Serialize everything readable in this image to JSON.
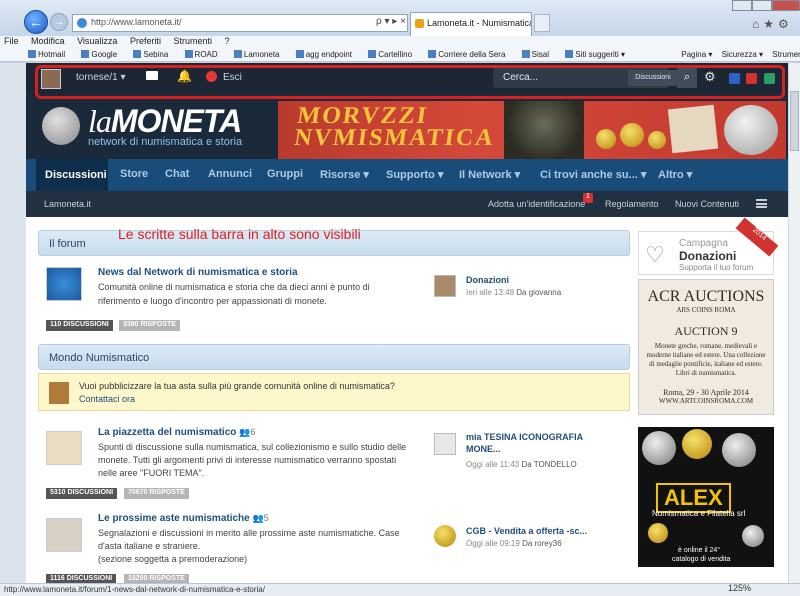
{
  "browser": {
    "url": "http://www.lamoneta.it/",
    "tab_title": "Lamoneta.it - Numismatica...",
    "url_tools": "ρ ▾ ▸ ×",
    "menu": [
      "File",
      "Modifica",
      "Visualizza",
      "Preferiti",
      "Strumenti",
      "?"
    ],
    "favorites": [
      "Hotmail",
      "Google",
      "Sebina",
      "ROAD",
      "Lamoneta",
      "agg endpoint",
      "Cartellino",
      "Corriere della Sera",
      "Sisal",
      "Siti suggeriti ▾"
    ],
    "fav_right": [
      "Pagina ▾",
      "Sicurezza ▾",
      "Strumenti ▾"
    ],
    "status_url": "http://www.lamoneta.it/forum/1-news-dal-network-di-numismatica-e-storia/",
    "zoom": "125%"
  },
  "topbar": {
    "username": "tornese/1 ▾",
    "logout": "Esci",
    "search_placeholder": "Cerca...",
    "search_scope": "Discussioni"
  },
  "site": {
    "logo_la": "la",
    "logo_main": "MONETA",
    "tagline": "network di numismatica e storia",
    "banner_line1": "MORVZZI",
    "banner_line2": "NVMISMATICA"
  },
  "nav": {
    "active": "Discussioni",
    "items": [
      "Store",
      "Chat",
      "Annunci",
      "Gruppi",
      "Risorse ▾",
      "Supporto ▾",
      "Il Network ▾",
      "Ci trovi anche su... ▾",
      "Altro ▾"
    ]
  },
  "subnav": {
    "breadcrumb": "Lamoneta.it",
    "links": [
      "Adotta un'identificazione",
      "Regolamento",
      "Nuovi Contenuti"
    ],
    "badge": "1"
  },
  "annotation": "Le scritte sulla barra in alto sono visibili",
  "sections": {
    "forum": "Il forum",
    "mondo": "Mondo Numismatico"
  },
  "forums": [
    {
      "title": "News dal Network di numismatica e storia",
      "desc1": "Comunità online di numismatica e storia che da dieci anni è punto di",
      "desc2": "riferimento e luogo d'incontro per appassionati di monete.",
      "desc3": "",
      "discussions": "110 DISCUSSIONI",
      "replies": "3380 RISPOSTE",
      "last_title": "Donazioni",
      "last_title2": "",
      "last_time": "Ieri alle 13:48",
      "last_author": "Da giovanna"
    },
    {
      "title": "La piazzetta del numismatico",
      "viewers": "6",
      "desc1": "Spunti di discussione sulla numismatica, sul collezionismo e sullo studio delle",
      "desc2": "monete. Tutti gli argomenti privi di interesse numismatico verranno spostati",
      "desc3": "nelle aree \"FUORI TEMA\".",
      "discussions": "5310 DISCUSSIONI",
      "replies": "70670 RISPOSTE",
      "last_title": "mia TESINA ICONOGRAFIA",
      "last_title2": "MONE...",
      "last_time": "Oggi alle 11:43",
      "last_author": "Da TONDELLO"
    },
    {
      "title": "Le prossime aste numismatiche",
      "viewers": "5",
      "desc1": "Segnalazioni e discussioni in merito alle prossime aste numismatiche. Case",
      "desc2": "d'asta italiane e straniere.",
      "desc3": "(sezione soggetta a premoderazione)",
      "discussions": "1116 DISCUSSIONI",
      "replies": "15290 RISPOSTE",
      "last_title": "CGB - Vendita a offerta -sc...",
      "last_title2": "",
      "last_time": "Oggi alle 09:19",
      "last_author": "Da rorey36"
    }
  ],
  "ad": {
    "line1": "Vuoi pubblicizzare la tua asta sulla più grande comunità online di numismatica?",
    "line2": "Contattaci ora"
  },
  "sidebar": {
    "don_1": "Campagna",
    "don_2": "Donazioni",
    "don_3": "Supporta il tuo forum",
    "don_year": "2014",
    "acr_1": "ACR AUCTIONS",
    "acr_2": "ARS COINS ROMA",
    "acr_3": "AUCTION 9",
    "acr_4": "Monete greche, romane, medievali e moderne italiane ed estere. Una collezione di medaglie pontificie, italiane ed estere. Libri di numismatica.",
    "acr_5": "Roma, 29 - 30 Aprile 2014",
    "acr_6": "WWW.ARTCOINSROMA.COM",
    "alex_logo": "ALEX",
    "alex_sub": "Numismatica e Filatelia srl",
    "alex_b1": "è online il 24°",
    "alex_b2": "catalogo di vendita"
  },
  "colors": {
    "topbar": "#1d2733",
    "nav": "#1a4c7a",
    "highlight": "#d42121",
    "annotation": "#e02020"
  }
}
